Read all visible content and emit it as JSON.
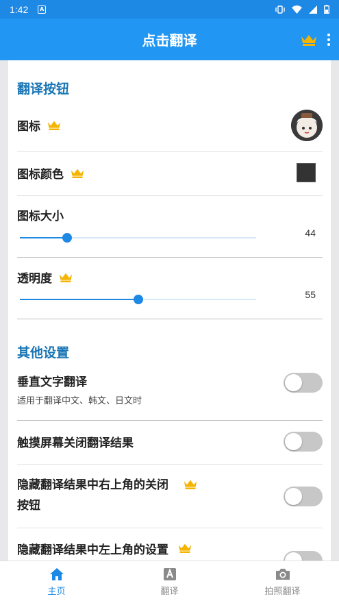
{
  "status_bar": {
    "time": "1:42",
    "app_icon_letter": "A"
  },
  "app_bar": {
    "title": "点击翻译"
  },
  "sections": {
    "translate_button": {
      "header": "翻译按钮",
      "icon_label": "图标",
      "icon_color_label": "图标颜色",
      "icon_size_label": "图标大小",
      "icon_size_value": "44",
      "icon_size_fraction": 0.2,
      "opacity_label": "透明度",
      "opacity_value": "55",
      "opacity_fraction": 0.5
    },
    "other_settings": {
      "header": "其他设置",
      "vertical_label": "垂直文字翻译",
      "vertical_sublabel": "适用于翻译中文、韩文、日文时",
      "touch_close_label": "触摸屏幕关闭翻译结果",
      "hide_close_label_line1": "隐藏翻译结果中右上角的关闭",
      "hide_close_label_line2": "按钮",
      "hide_settings_label": "隐藏翻译结果中左上角的设置"
    }
  },
  "bottom_nav": [
    {
      "label": "主页",
      "icon": "home-icon",
      "active": true
    },
    {
      "label": "翻译",
      "icon": "translate-icon",
      "active": false
    },
    {
      "label": "拍照翻译",
      "icon": "camera-icon",
      "active": false
    }
  ],
  "colors": {
    "primary": "#2196f3",
    "accent": "#1e88e5",
    "crown": "#f5b400",
    "section_header": "#1976b5"
  }
}
